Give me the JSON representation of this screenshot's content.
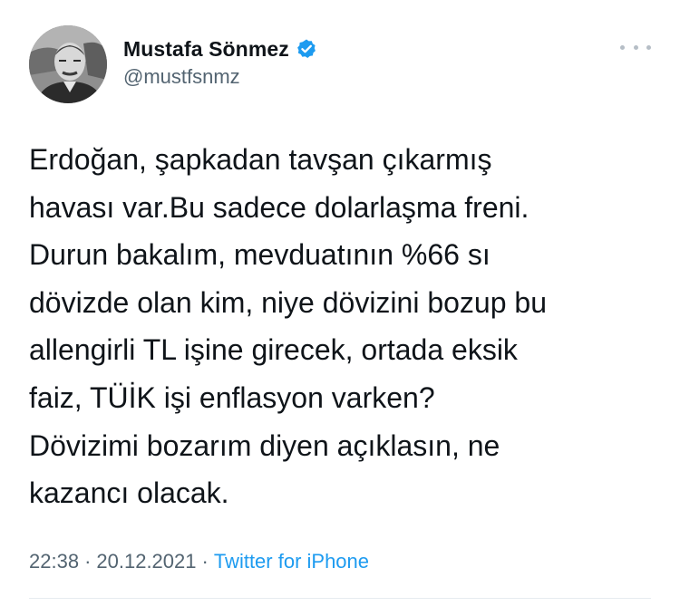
{
  "author": {
    "display_name": "Mustafa Sönmez",
    "handle": "@mustfsnmz",
    "verified": true,
    "avatar_icon": "profile-photo-icon",
    "verified_icon": "verified-badge-icon"
  },
  "menu": {
    "icon": "more-options-icon"
  },
  "tweet": {
    "lines": [
      "Erdoğan, şapkadan tavşan çıkarmış",
      "havası var.Bu sadece dolarlaşma freni.",
      "Durun bakalım, mevduatının %66 sı",
      "dövizde olan kim, niye dövizini bozup bu",
      "allengirli TL işine girecek, ortada eksik",
      "faiz, TÜİK işi enflasyon varken?",
      "Dövizimi bozarım diyen açıklasın, ne",
      "kazancı olacak."
    ]
  },
  "meta": {
    "time": "22:38",
    "separator": "·",
    "date": "20.12.2021",
    "source": "Twitter for iPhone"
  },
  "colors": {
    "text": "#0f1419",
    "secondary": "#536471",
    "link": "#1d9bf0",
    "verified": "#1d9bf0",
    "divider": "#e6ecf0"
  }
}
